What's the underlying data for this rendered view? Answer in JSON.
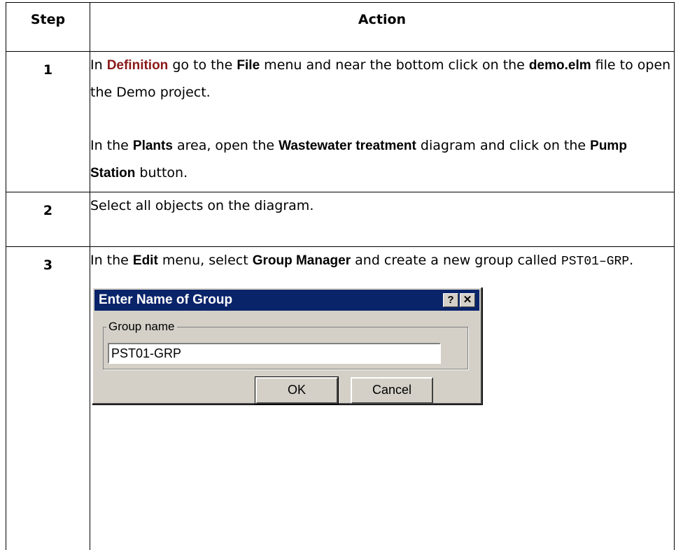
{
  "table": {
    "header": {
      "step": "Step",
      "action": "Action"
    },
    "rows": [
      {
        "step": "1",
        "p1": {
          "t1": "In ",
          "b1": "Definition",
          "t2": " go to the ",
          "b2": "File",
          "t3": " menu and near the bottom click on the ",
          "b3": "demo.elm",
          "t4": " file to open the Demo project."
        },
        "p2": {
          "t1": "In the ",
          "b1": "Plants",
          "t2": " area, open the ",
          "b2": "Wastewater treatment",
          "t3": " diagram and click on the ",
          "b3": "Pump Station",
          "t4": " button."
        }
      },
      {
        "step": "2",
        "text": "Select all objects on the diagram."
      },
      {
        "step": "3",
        "p1": {
          "t1": "In the ",
          "b1": "Edit",
          "t2": " menu, select ",
          "b2": "Group Manager",
          "t3": " and create a new group called ",
          "code": "PST01–GRP",
          "t4": "."
        }
      }
    ]
  },
  "dialog": {
    "title": "Enter Name of Group",
    "help_glyph": "?",
    "close_glyph": "✕",
    "group_label": "Group name",
    "group_value": "PST01-GRP",
    "ok": "OK",
    "cancel": "Cancel"
  },
  "colors": {
    "definition": "#8a1a1a",
    "titlebar": "#0a246a",
    "dialog_bg": "#d4d0c8"
  }
}
